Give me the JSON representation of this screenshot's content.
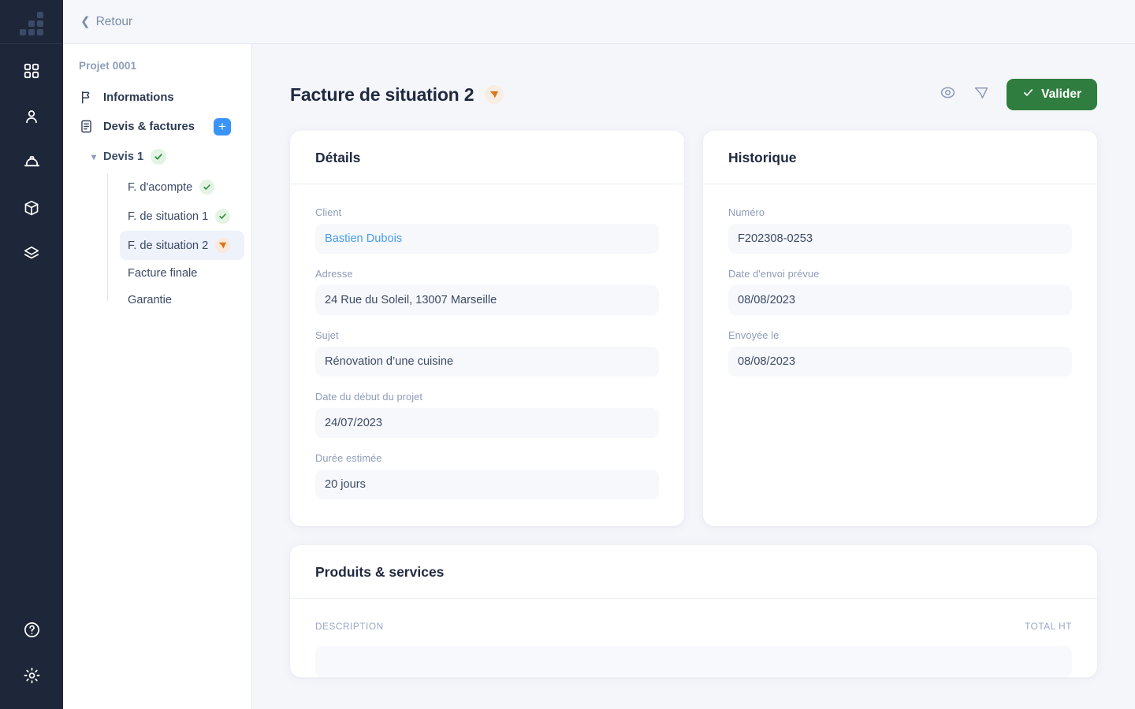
{
  "rail": {
    "logo_name": "app-logo",
    "items": [
      {
        "icon": "grid-dashboard-icon",
        "name": "rail-item-dashboard"
      },
      {
        "icon": "user-icon",
        "name": "rail-item-clients"
      },
      {
        "icon": "hard-hat-icon",
        "name": "rail-item-worksites"
      },
      {
        "icon": "package-icon",
        "name": "rail-item-products"
      },
      {
        "icon": "layers-icon",
        "name": "rail-item-library"
      }
    ],
    "bottom": [
      {
        "icon": "help-circle-icon",
        "name": "rail-item-help"
      },
      {
        "icon": "gear-icon",
        "name": "rail-item-settings"
      }
    ]
  },
  "sidebar": {
    "back_label": "Retour",
    "back_icon": "chevron-left-icon",
    "project_label": "Projet 0001",
    "nav": [
      {
        "label": "Informations",
        "icon": "flag-icon"
      },
      {
        "label": "Devis & factures",
        "icon": "document-icon",
        "action_icon": "plus-icon",
        "action_label": "+"
      }
    ],
    "group": {
      "label": "Devis 1",
      "chevron": "▾",
      "status": "validated",
      "status_icon": "check-icon",
      "items": [
        {
          "label": "F. d'acompte",
          "status": "validated",
          "status_icon": "check-icon",
          "active": false
        },
        {
          "label": "F. de situation 1",
          "status": "validated",
          "status_icon": "check-icon",
          "active": false
        },
        {
          "label": "F. de situation 2",
          "status": "sent",
          "status_icon": "send-icon",
          "active": true
        },
        {
          "label": "Facture finale",
          "status": "none",
          "active": false
        },
        {
          "label": "Garantie",
          "status": "none",
          "active": false
        }
      ]
    }
  },
  "header": {
    "title": "Facture de situation 2",
    "status_icon": "send-icon",
    "actions": [
      {
        "name": "preview",
        "icon": "eye-icon"
      },
      {
        "name": "send",
        "icon": "send-icon"
      }
    ],
    "validate_label": "Valider",
    "validate_icon": "check-icon",
    "validate_color": "#2f7d3f"
  },
  "details_card": {
    "title": "Détails",
    "fields": [
      {
        "label": "Client",
        "value": "Bastien Dubois",
        "is_link": true
      },
      {
        "label": "Adresse",
        "value": "24 Rue du Soleil, 13007 Marseille",
        "is_link": false
      },
      {
        "label": "Sujet",
        "value": "Rénovation d’une cuisine",
        "is_link": false
      },
      {
        "label": "Date du début du projet",
        "value": "24/07/2023",
        "is_link": false
      },
      {
        "label": "Durée estimée",
        "value": "20 jours",
        "is_link": false
      }
    ]
  },
  "history_card": {
    "title": "Historique",
    "fields": [
      {
        "label": "Numéro",
        "value": "F202308-0253"
      },
      {
        "label": "Date d'envoi prévue",
        "value": "08/08/2023"
      },
      {
        "label": "Envoyée le",
        "value": "08/08/2023"
      }
    ]
  },
  "products_card": {
    "title": "Produits & services",
    "columns": {
      "description": "DESCRIPTION",
      "total": "TOTAL HT"
    }
  },
  "colors": {
    "rail_bg": "#1e2639",
    "accent_blue": "#3b93f7",
    "link_blue": "#4a9cf0",
    "green": "#2f7d3f",
    "orange": "#d9741a",
    "page_bg": "#f5f6fa"
  }
}
